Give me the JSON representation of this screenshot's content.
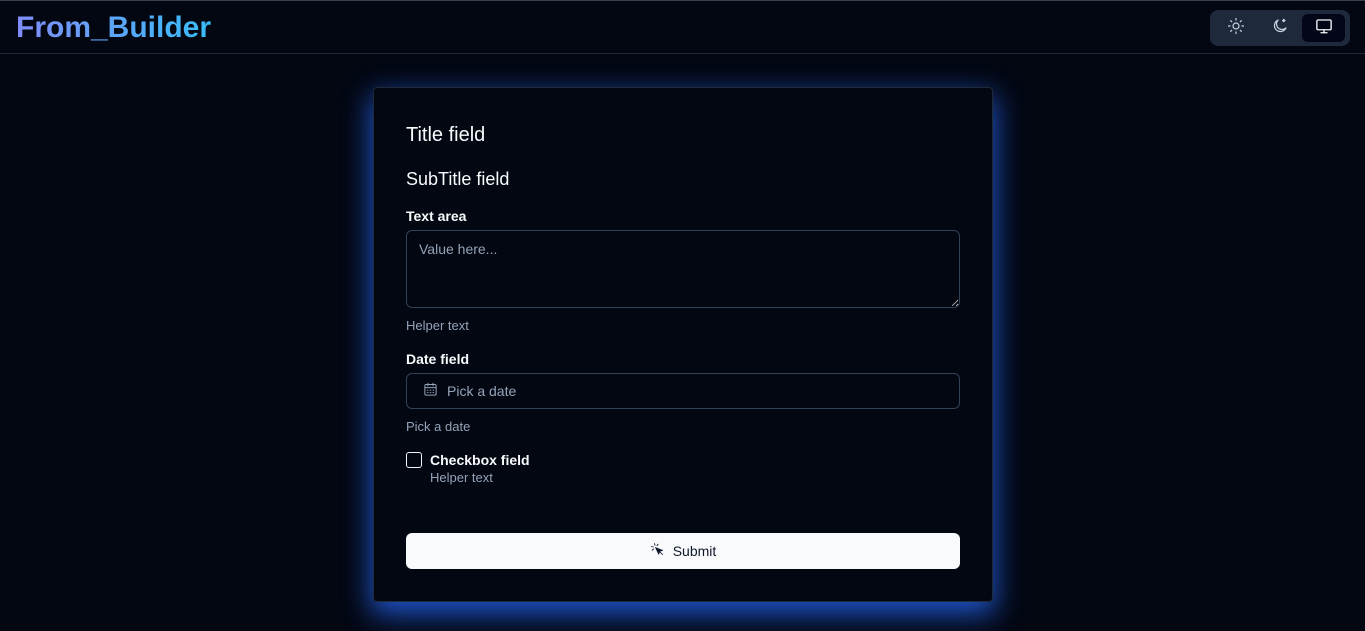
{
  "header": {
    "brand": "From_Builder",
    "theme_toggle": {
      "options": [
        {
          "name": "light",
          "icon": "sun-icon"
        },
        {
          "name": "dark",
          "icon": "moon-icon"
        },
        {
          "name": "system",
          "icon": "monitor-icon"
        }
      ],
      "active": "system"
    }
  },
  "form": {
    "title": "Title field",
    "subtitle": "SubTitle field",
    "textarea": {
      "label": "Text area",
      "placeholder": "Value here...",
      "value": "",
      "helper": "Helper text"
    },
    "date": {
      "label": "Date field",
      "button_text": "Pick a date",
      "icon": "calendar-icon",
      "helper": "Pick a date"
    },
    "checkbox": {
      "label": "Checkbox field",
      "helper": "Helper text",
      "checked": false
    },
    "submit": {
      "label": "Submit",
      "icon": "cursor-click-icon"
    }
  },
  "colors": {
    "background": "#030712",
    "brand_gradient_start": "#818cf8",
    "brand_gradient_end": "#38bdf8",
    "card_glow": "#2563eb",
    "submit_bg": "#f8fafc"
  }
}
